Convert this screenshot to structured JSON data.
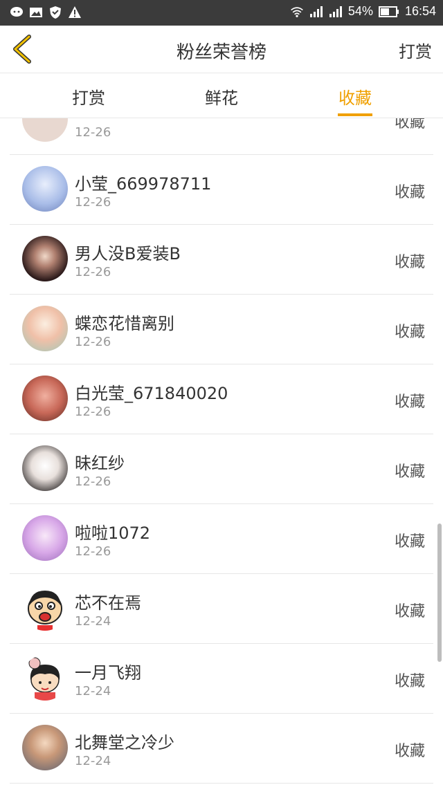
{
  "status": {
    "battery": "54%",
    "time": "16:54",
    "icons": [
      "chat-icon",
      "image-icon",
      "shield-icon",
      "warning-icon"
    ]
  },
  "nav": {
    "title": "粉丝荣誉榜",
    "action": "打赏"
  },
  "tabs": [
    {
      "label": "打赏"
    },
    {
      "label": "鲜花"
    },
    {
      "label": "收藏",
      "active": true
    }
  ],
  "accent_color": "#f0a000",
  "list": [
    {
      "name": "",
      "date": "12-26",
      "action": "收藏",
      "avatar": "#e8d8d0"
    },
    {
      "name": "小莹_669978711",
      "date": "12-26",
      "action": "收藏",
      "avatar": "#b0c4f0"
    },
    {
      "name": "男人没B爱装B",
      "date": "12-26",
      "action": "收藏",
      "avatar": "#5a3a3a"
    },
    {
      "name": "蝶恋花惜离别",
      "date": "12-26",
      "action": "收藏",
      "avatar": "#f0c8b8"
    },
    {
      "name": "白光莹_671840020",
      "date": "12-26",
      "action": "收藏",
      "avatar": "#d28070"
    },
    {
      "name": "昧红纱",
      "date": "12-26",
      "action": "收藏",
      "avatar": "#d8d8d8"
    },
    {
      "name": "啦啦1072",
      "date": "12-26",
      "action": "收藏",
      "avatar": "#d8b0e0"
    },
    {
      "name": "芯不在焉",
      "date": "12-24",
      "action": "收藏",
      "avatar": "#ffffff"
    },
    {
      "name": "一月飞翔",
      "date": "12-24",
      "action": "收藏",
      "avatar": "#ffffff"
    },
    {
      "name": "北舞堂之冷少",
      "date": "12-24",
      "action": "收藏",
      "avatar": "#a0b0c0"
    }
  ]
}
